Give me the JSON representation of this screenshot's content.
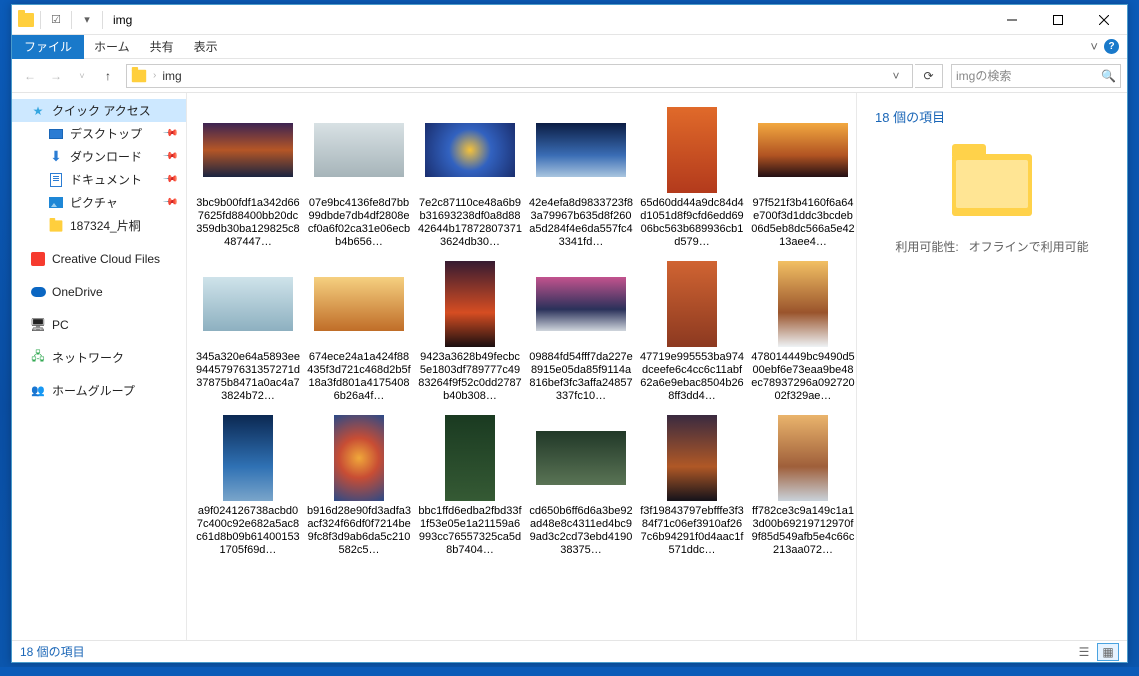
{
  "window": {
    "title": "img"
  },
  "menu": {
    "file": "ファイル",
    "home": "ホーム",
    "share": "共有",
    "view": "表示",
    "collapse": "˅"
  },
  "address": {
    "crumb0": "",
    "crumb1": "img",
    "refresh": "⟳",
    "dropdown": "˅"
  },
  "search": {
    "placeholder": "imgの検索"
  },
  "nav": {
    "quick": "クイック アクセス",
    "desktop": "デスクトップ",
    "downloads": "ダウンロード",
    "documents": "ドキュメント",
    "pictures": "ピクチャ",
    "custom_folder": "187324_片桐",
    "ccf": "Creative Cloud Files",
    "onedrive": "OneDrive",
    "pc": "PC",
    "network": "ネットワーク",
    "homegroup": "ホームグループ"
  },
  "details": {
    "count": "18 個の項目",
    "availability_label": "利用可能性:",
    "availability_value": "オフラインで利用可能"
  },
  "status": {
    "text": "18 個の項目"
  },
  "items": [
    {
      "name": "3bc9b00fdf1a342d667625fd88400bb20dc359db30ba129825c8487447…",
      "shape": "wide",
      "g": "g1"
    },
    {
      "name": "07e9bc4136fe8d7bb99dbde7db4df2808ecf0a6f02ca31e06ecbb4b656…",
      "shape": "wide",
      "g": "g2"
    },
    {
      "name": "7e2c87110ce48a6b9b31693238df0a8d8842644b178728073713624db30…",
      "shape": "wide",
      "g": "g3"
    },
    {
      "name": "42e4efa8d9833723f83a79967b635d8f260a5d284f4e6da557fc43341fd…",
      "shape": "wide",
      "g": "g4"
    },
    {
      "name": "65d60dd44a9dc84d4d1051d8f9cfd6edd6906bc563b689936cb1d579…",
      "shape": "tall",
      "g": "g5"
    },
    {
      "name": "97f521f3b4160f6a64e700f3d1ddc3bcdeb06d5eb8dc566a5e4213aee4…",
      "shape": "wide",
      "g": "g6"
    },
    {
      "name": "345a320e64a5893ee9445797631357271d37875b8471a0ac4a73824b72…",
      "shape": "wide",
      "g": "g7"
    },
    {
      "name": "674ece24a1a424f88435f3d721c468d2b5f18a3fd801a41754086b26a4f…",
      "shape": "wide",
      "g": "g8"
    },
    {
      "name": "9423a3628b49fecbc5e1803df789777c4983264f9f52c0dd2787b40b308…",
      "shape": "tall",
      "g": "g9"
    },
    {
      "name": "09884fd54fff7da227e8915e05da85f9114a816bef3fc3affa24857337fc10…",
      "shape": "wide",
      "g": "g10"
    },
    {
      "name": "47719e995553ba974dceefe6c4cc6c11abf62a6e9ebac8504b268ff3dd4…",
      "shape": "tall",
      "g": "g11"
    },
    {
      "name": "478014449bc9490d500ebf6e73eaa9be48ec78937296a09272002f329ae…",
      "shape": "tall",
      "g": "g12"
    },
    {
      "name": "a9f024126738acbd07c400c92e682a5ac8c61d8b09b614001531705f69d…",
      "shape": "tall",
      "g": "g13"
    },
    {
      "name": "b916d28e90fd3adfa3acf324f66df0f7214be9fc8f3d9ab6da5c210582c5…",
      "shape": "tall",
      "g": "g14"
    },
    {
      "name": "bbc1ffd6edba2fbd33f1f53e05e1a21159a6993cc76557325ca5d8b7404…",
      "shape": "tall",
      "g": "g15"
    },
    {
      "name": "cd650b6ff6d6a3be92ad48e8c4311ed4bc99ad3c2cd73ebd419038375…",
      "shape": "wide",
      "g": "g16"
    },
    {
      "name": "f3f19843797ebfffe3f384f71c06ef3910af267c6b94291f0d4aac1f571ddc…",
      "shape": "tall",
      "g": "g17"
    },
    {
      "name": "ff782ce3c9a149c1a13d00b69219712970f9f85d549afb5e4c66c213aa072…",
      "shape": "tall",
      "g": "g18"
    }
  ]
}
